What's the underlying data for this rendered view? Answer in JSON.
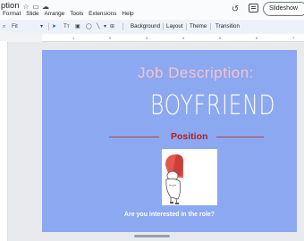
{
  "app": {
    "doc_title": "ption",
    "menu": [
      "Format",
      "Slide",
      "Arrange",
      "Tools",
      "Extensions",
      "Help"
    ],
    "slideshow_label": "Slideshow"
  },
  "toolbar": {
    "zoom": "Fit",
    "buttons": [
      "Background",
      "Layout",
      "Theme",
      "Transition"
    ]
  },
  "ruler_marks": [
    "1",
    "2",
    "3",
    "4",
    "5",
    "6",
    "7"
  ],
  "slide": {
    "background": "#8ca8f0",
    "title": "Job Description:",
    "subtitle": "BOYFRIEND",
    "section_label": "Position",
    "question": "Are you interested in the role?"
  },
  "colors": {
    "title": "#f6c3cc",
    "section_label": "#b41f26",
    "rule": "#a9464a"
  }
}
